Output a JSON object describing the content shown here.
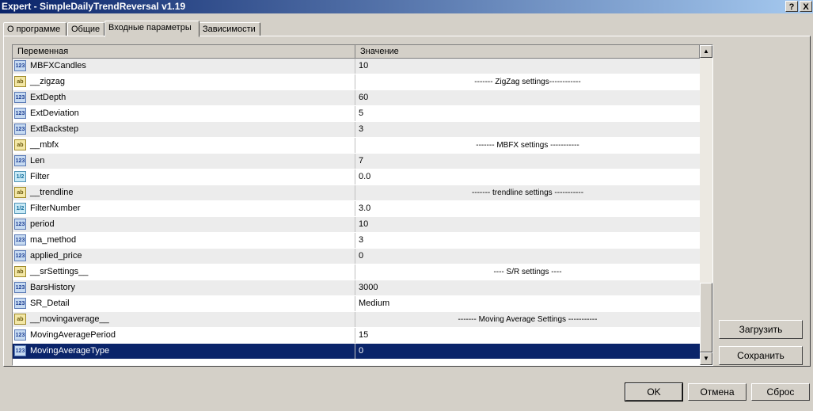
{
  "window": {
    "title": "Expert - SimpleDailyTrendReversal v1.19",
    "help_glyph": "?",
    "close_glyph": "X"
  },
  "tabs": [
    {
      "label": "О программе"
    },
    {
      "label": "Общие"
    },
    {
      "label": "Входные параметры"
    },
    {
      "label": "Зависимости"
    }
  ],
  "grid": {
    "header": {
      "variable": "Переменная",
      "value": "Значение"
    },
    "rows": [
      {
        "type": "int",
        "icon": "123",
        "name": "MBFXCandles",
        "value": "10"
      },
      {
        "type": "string",
        "icon": "ab",
        "name": "__zigzag",
        "value": "------- ZigZag settings------------"
      },
      {
        "type": "int",
        "icon": "123",
        "name": "ExtDepth",
        "value": "60"
      },
      {
        "type": "int",
        "icon": "123",
        "name": "ExtDeviation",
        "value": "5"
      },
      {
        "type": "int",
        "icon": "123",
        "name": "ExtBackstep",
        "value": "3"
      },
      {
        "type": "string",
        "icon": "ab",
        "name": "__mbfx",
        "value": "------- MBFX settings -----------"
      },
      {
        "type": "int",
        "icon": "123",
        "name": "Len",
        "value": "7"
      },
      {
        "type": "double",
        "icon": "1/2",
        "name": "Filter",
        "value": "0.0"
      },
      {
        "type": "string",
        "icon": "ab",
        "name": "__trendline",
        "value": "------- trendline settings -----------"
      },
      {
        "type": "double",
        "icon": "1/2",
        "name": "FilterNumber",
        "value": "3.0"
      },
      {
        "type": "int",
        "icon": "123",
        "name": "period",
        "value": "10"
      },
      {
        "type": "int",
        "icon": "123",
        "name": "ma_method",
        "value": "3"
      },
      {
        "type": "int",
        "icon": "123",
        "name": "applied_price",
        "value": "0"
      },
      {
        "type": "string",
        "icon": "ab",
        "name": "__srSettings__",
        "value": "---- S/R settings ----"
      },
      {
        "type": "int",
        "icon": "123",
        "name": "BarsHistory",
        "value": "3000"
      },
      {
        "type": "int",
        "icon": "123",
        "name": "SR_Detail",
        "value": "Medium"
      },
      {
        "type": "string",
        "icon": "ab",
        "name": "__movingaverage__",
        "value": "------- Moving Average Settings -----------"
      },
      {
        "type": "int",
        "icon": "123",
        "name": "MovingAveragePeriod",
        "value": "15"
      },
      {
        "type": "int",
        "icon": "123",
        "name": "MovingAverageType",
        "value": "0",
        "selected": true
      }
    ],
    "scroll_up_glyph": "▲",
    "scroll_down_glyph": "▼"
  },
  "side_buttons": {
    "load": "Загрузить",
    "save": "Сохранить"
  },
  "footer_buttons": {
    "ok": "OK",
    "cancel": "Отмена",
    "reset": "Сброс"
  }
}
